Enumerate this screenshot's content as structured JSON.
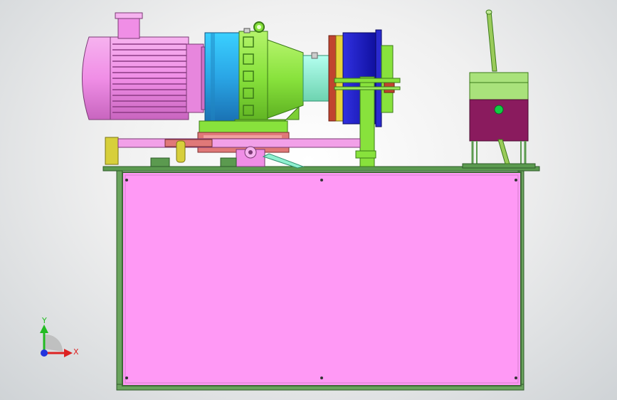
{
  "viewport": {
    "background_top": "#ffffff",
    "background_bottom": "#cfd3d6"
  },
  "triad": {
    "y_label": "Y",
    "x_label": "X",
    "y_color": "#22bb22",
    "x_color": "#dd2222",
    "z_color": "#2233dd"
  },
  "model": {
    "parts": [
      "electric-motor",
      "motor-terminal-box",
      "cycloidal-reducer",
      "coupling",
      "brake-disc",
      "motor-bracket",
      "adjusting-rod",
      "control-box",
      "hand-lever",
      "base-frame",
      "front-panel"
    ],
    "colors": {
      "motor": "#f08ee6",
      "reducer_blue": "#2aa6e6",
      "reducer_green": "#88e23c",
      "coupling": "#8ff0d0",
      "disc_red": "#c0432f",
      "disc_yellow": "#e6d33a",
      "disc_blue": "#2020c8",
      "frame": "#5b9a4f",
      "panel": "#ff99f5",
      "control_box_top": "#a9e27b",
      "control_box_body": "#8a1b5e",
      "indicator": "#11cc44",
      "rod": "#f2a0e8",
      "bracket_yellow": "#d7cf3b",
      "pillow_block": "#e07878"
    }
  }
}
